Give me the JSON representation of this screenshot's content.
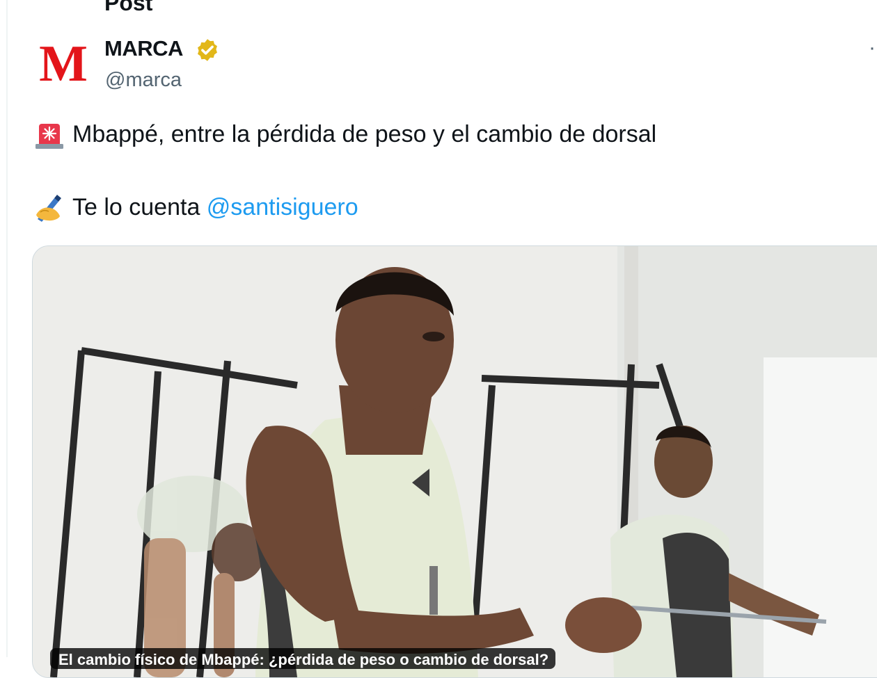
{
  "header_fragment": "Post",
  "author": {
    "name": "MARCA",
    "handle": "@marca",
    "logo_letter": "M",
    "verified_color": "#e2b719"
  },
  "tweet": {
    "line1_icon": "rotating-light-emoji",
    "line1_text": "Mbappé, entre la pérdida de peso y el cambio de dorsal",
    "line2_icon": "writing-hand-emoji",
    "line2_prefix": "Te lo cuenta ",
    "line2_mention": "@santisiguero"
  },
  "media": {
    "alt": "Mbappé training in gym",
    "caption": "El cambio físico de Mbappé: ¿pérdida de peso o cambio de dorsal?"
  },
  "more_glyph": "·",
  "colors": {
    "brand_red": "#e3151a",
    "link_blue": "#1d9bf0",
    "muted": "#536471"
  }
}
